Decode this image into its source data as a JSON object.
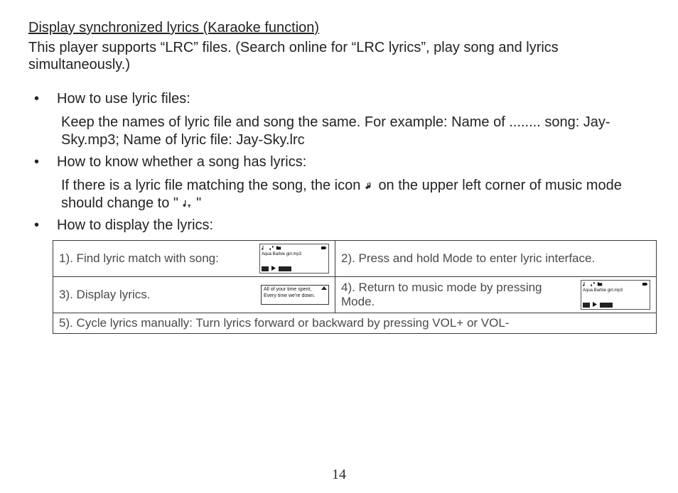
{
  "heading": "Display synchronized lyrics (Karaoke function)",
  "intro": "This player supports “LRC” files. (Search online for “LRC lyrics”, play song and lyrics simultaneously.)",
  "bullets": {
    "b1": {
      "title": "How to use lyric files:",
      "body": "Keep the names of lyric file and song the same.  For example:  Name of ........ song: Jay-Sky.mp3;  Name of lyric file: Jay-Sky.lrc"
    },
    "b2": {
      "title": "How to know whether a song has lyrics:",
      "body_a": "If there is a lyric file matching the song, the icon ",
      "body_b": " on the upper left corner of music mode should change to   \"",
      "body_c": "\""
    },
    "b3": {
      "title": "How to display the lyrics:"
    }
  },
  "table": {
    "r1c1": "1). Find lyric match with song:",
    "r1c2": "2). Press and hold Mode to enter lyric interface.",
    "r2c1": "3). Display lyrics.",
    "r2c2": "4). Return to music mode by pressing Mode.",
    "r3": "5). Cycle lyrics manually: Turn lyrics forward or backward by pressing VOL+ or VOL-"
  },
  "mini": {
    "song_title": "Aqua Barbie girl.mp3",
    "lyric_line1": "All of your time spent,",
    "lyric_line2": "Every time we're down."
  },
  "page_number": "14"
}
